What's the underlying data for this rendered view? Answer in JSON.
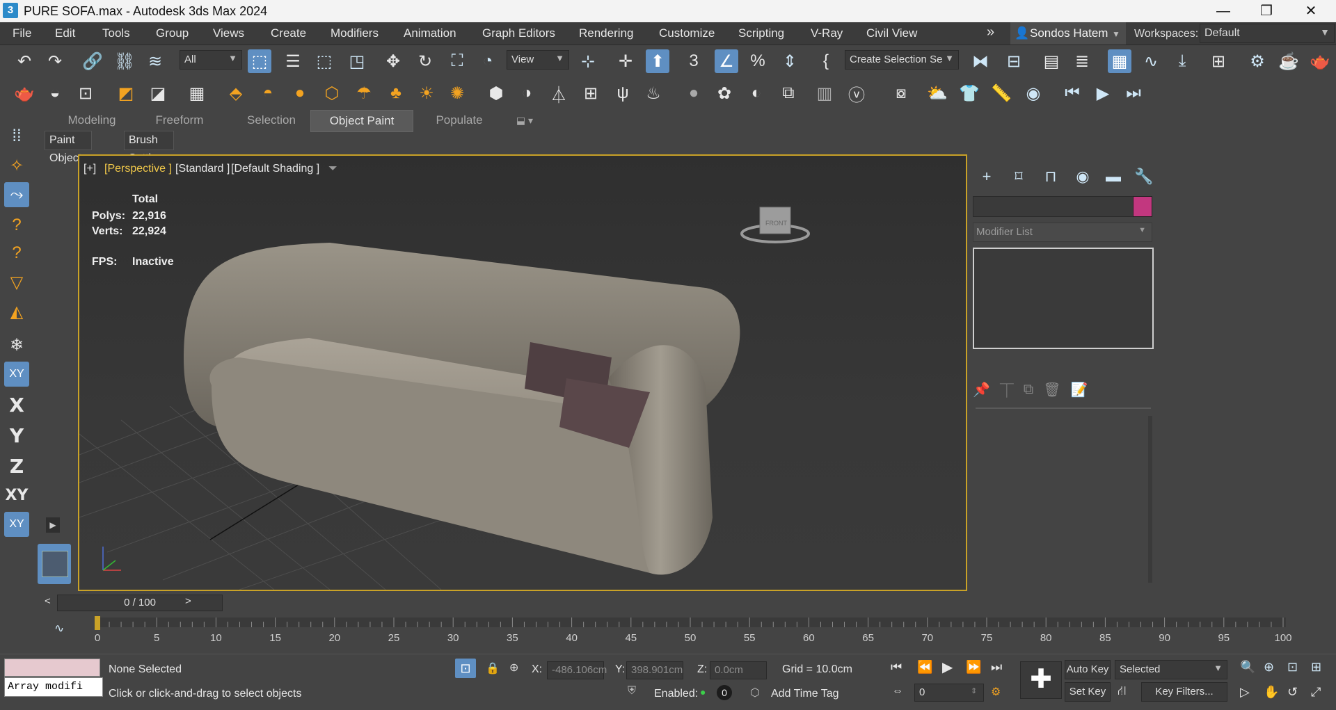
{
  "window": {
    "title": "PURE SOFA.max - Autodesk 3ds Max 2024",
    "app_icon": "3",
    "controls": [
      "—",
      "❐",
      "✕"
    ]
  },
  "menu": {
    "items": [
      "File",
      "Edit",
      "Tools",
      "Group",
      "Views",
      "Create",
      "Modifiers",
      "Animation",
      "Graph Editors",
      "Rendering",
      "Customize",
      "Scripting",
      "V-Ray",
      "Civil View"
    ],
    "overflow": "»",
    "user": "Sondos Hatem",
    "workspaces_label": "Workspaces:",
    "workspace_value": "Default"
  },
  "toolbar": {
    "filter_value": "All",
    "ref_coord_value": "View",
    "selection_set_value": "Create Selection Se"
  },
  "ribbon": {
    "tabs": [
      "Modeling",
      "Freeform",
      "Selection",
      "Object Paint",
      "Populate"
    ],
    "active_tab": "Object Paint",
    "buttons": [
      "Paint Objects",
      "Brush Settings"
    ]
  },
  "left_toolbar": {
    "axis_labels": [
      "X",
      "Y",
      "Z",
      "XY"
    ]
  },
  "viewport": {
    "label_plus": "[+]",
    "label_view": "[Perspective ]",
    "label_standard": "[Standard ]",
    "label_shading": "[Default Shading ]",
    "stats": {
      "total_label": "Total",
      "polys_label": "Polys:",
      "polys_value": "22,916",
      "verts_label": "Verts:",
      "verts_value": "22,924",
      "fps_label": "FPS:",
      "fps_value": "Inactive"
    },
    "viewcube_text": "FRONT"
  },
  "command_panel": {
    "name_field": "",
    "color_swatch": "#c2377f",
    "modifier_list_label": "Modifier List"
  },
  "timeline": {
    "slider_text": "0 / 100",
    "prev": "<",
    "next": ">",
    "ticks": [
      "0",
      "5",
      "10",
      "15",
      "20",
      "25",
      "30",
      "35",
      "40",
      "45",
      "50",
      "55",
      "60",
      "65",
      "70",
      "75",
      "80",
      "85",
      "90",
      "95",
      "100"
    ]
  },
  "status": {
    "maxscript_value": "Array modifi",
    "selection_text": "None Selected",
    "prompt_text": "Click or click-and-drag to select objects",
    "x_label": "X:",
    "x_value": "-486.106cm",
    "y_label": "Y:",
    "y_value": "398.901cm",
    "z_label": "Z:",
    "z_value": "0.0cm",
    "grid_text": "Grid = 10.0cm",
    "enabled_label": "Enabled:",
    "enabled_count": "0",
    "add_time_tag": "Add Time Tag",
    "frame_value": "0",
    "auto_key": "Auto Key",
    "selected_value": "Selected",
    "set_key": "Set Key",
    "key_filters": "Key Filters..."
  }
}
